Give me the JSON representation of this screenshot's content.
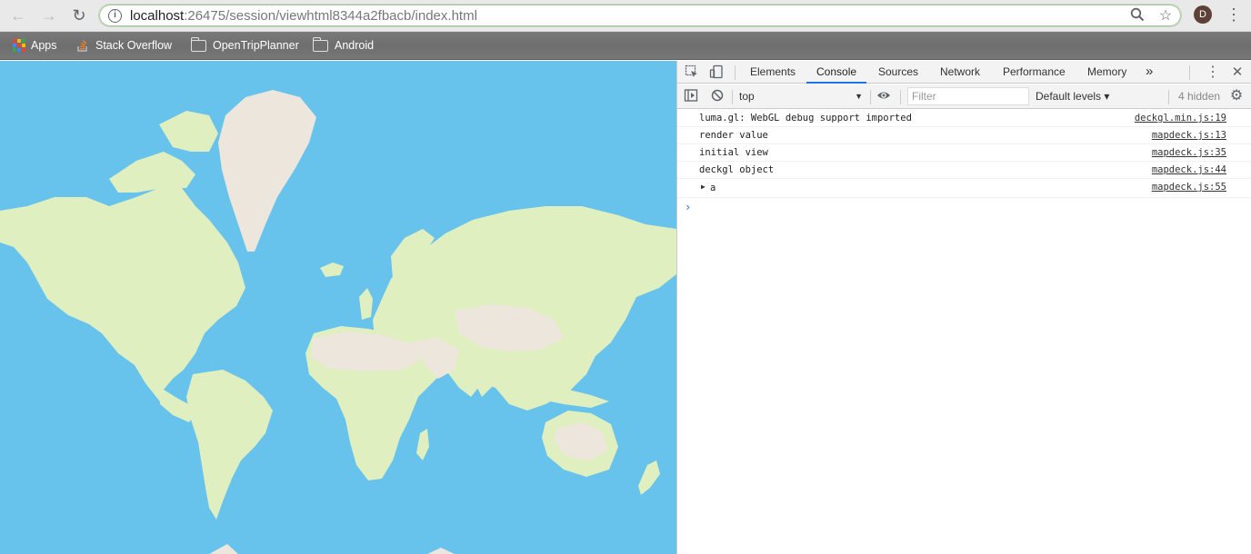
{
  "browser": {
    "url_host": "localhost",
    "url_path": ":26475/session/viewhtml8344a2fbacb/index.html",
    "profile_initial": "D",
    "bookmarks": [
      {
        "label": "Apps",
        "icon": "apps-grid-icon"
      },
      {
        "label": "Stack Overflow",
        "icon": "stackoverflow-icon"
      },
      {
        "label": "OpenTripPlanner",
        "icon": "folder-icon"
      },
      {
        "label": "Android",
        "icon": "folder-icon"
      }
    ]
  },
  "devtools": {
    "tabs": [
      "Elements",
      "Console",
      "Sources",
      "Network",
      "Performance",
      "Memory"
    ],
    "active_tab": "Console",
    "more_tabs": "»",
    "context": "top",
    "filter_placeholder": "Filter",
    "levels": "Default levels ▾",
    "hidden": "4 hidden",
    "messages": [
      {
        "text": "luma.gl: WebGL debug support imported",
        "source": "deckgl.min.js:19"
      },
      {
        "text": "render value",
        "source": "mapdeck.js:13"
      },
      {
        "text": "initial view",
        "source": "mapdeck.js:35"
      },
      {
        "text": "deckgl object",
        "source": "mapdeck.js:44"
      },
      {
        "text": "a",
        "source": "mapdeck.js:55",
        "expandable": true
      }
    ],
    "prompt": "›"
  },
  "colors": {
    "ocean": "#67c3ec",
    "land": "#e0efc0",
    "desert": "#ece6dc",
    "accent": "#1a73e8"
  }
}
